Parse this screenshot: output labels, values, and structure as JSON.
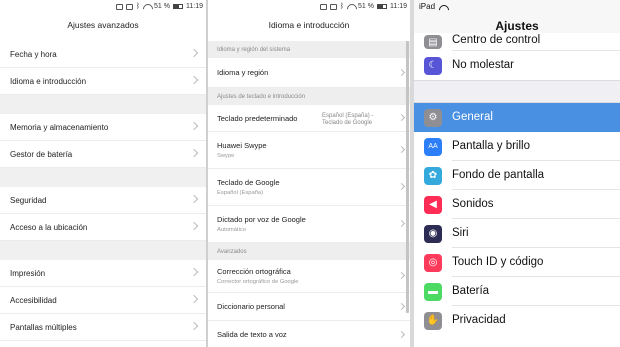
{
  "android_status": {
    "battery": "51 %",
    "time": "11:19"
  },
  "left": {
    "title": "Ajustes avanzados",
    "groups": [
      [
        "Fecha y hora",
        "Idioma e introducción"
      ],
      [
        "Memoria y almacenamiento",
        "Gestor de batería"
      ],
      [
        "Seguridad",
        "Acceso a la ubicación"
      ],
      [
        "Impresión",
        "Accesibilidad",
        "Pantallas múltiples"
      ]
    ]
  },
  "middle": {
    "title": "Idioma e introducción",
    "section_system": "Idioma y región del sistema",
    "row_language": "Idioma y región",
    "section_keyboard": "Ajustes de teclado e introducción",
    "row_default_keyboard": "Teclado predeterminado",
    "row_default_keyboard_value": "Español (España) - Teclado de Google",
    "row_swype": "Huawei Swype",
    "row_swype_sub": "Swype",
    "row_gboard": "Teclado de Google",
    "row_gboard_sub": "Español (España)",
    "row_voice": "Dictado por voz de Google",
    "row_voice_sub": "Automático",
    "section_advanced": "Avanzados",
    "row_spell": "Corrección ortográfica",
    "row_spell_sub": "Corrector ortográfico de Google",
    "row_dict": "Diccionario personal",
    "row_tts": "Salida de texto a voz"
  },
  "right": {
    "device": "iPad",
    "title": "Ajustes",
    "top_rows": [
      {
        "label": "Centro de control",
        "icon": "control-center-icon",
        "color": "#8e8e93",
        "glyph": "▤"
      },
      {
        "label": "No molestar",
        "icon": "moon-icon",
        "color": "#5856d6",
        "glyph": "☾"
      }
    ],
    "rows": [
      {
        "label": "General",
        "icon": "gear-icon",
        "color": "#8e8e93",
        "glyph": "⚙",
        "selected": true
      },
      {
        "label": "Pantalla y brillo",
        "icon": "display-brightness-icon",
        "color": "#2d7ff9",
        "glyph": "AA"
      },
      {
        "label": "Fondo de pantalla",
        "icon": "wallpaper-icon",
        "color": "#34aadc",
        "glyph": "✿"
      },
      {
        "label": "Sonidos",
        "icon": "speaker-icon",
        "color": "#ff2d55",
        "glyph": "◀"
      },
      {
        "label": "Siri",
        "icon": "siri-icon",
        "color": "#2c2c54",
        "glyph": "◉"
      },
      {
        "label": "Touch ID y código",
        "icon": "fingerprint-icon",
        "color": "#ff3b5c",
        "glyph": "◎"
      },
      {
        "label": "Batería",
        "icon": "battery-icon",
        "color": "#4cd964",
        "glyph": "▬"
      },
      {
        "label": "Privacidad",
        "icon": "privacy-hand-icon",
        "color": "#8e8e93",
        "glyph": "✋"
      }
    ]
  }
}
